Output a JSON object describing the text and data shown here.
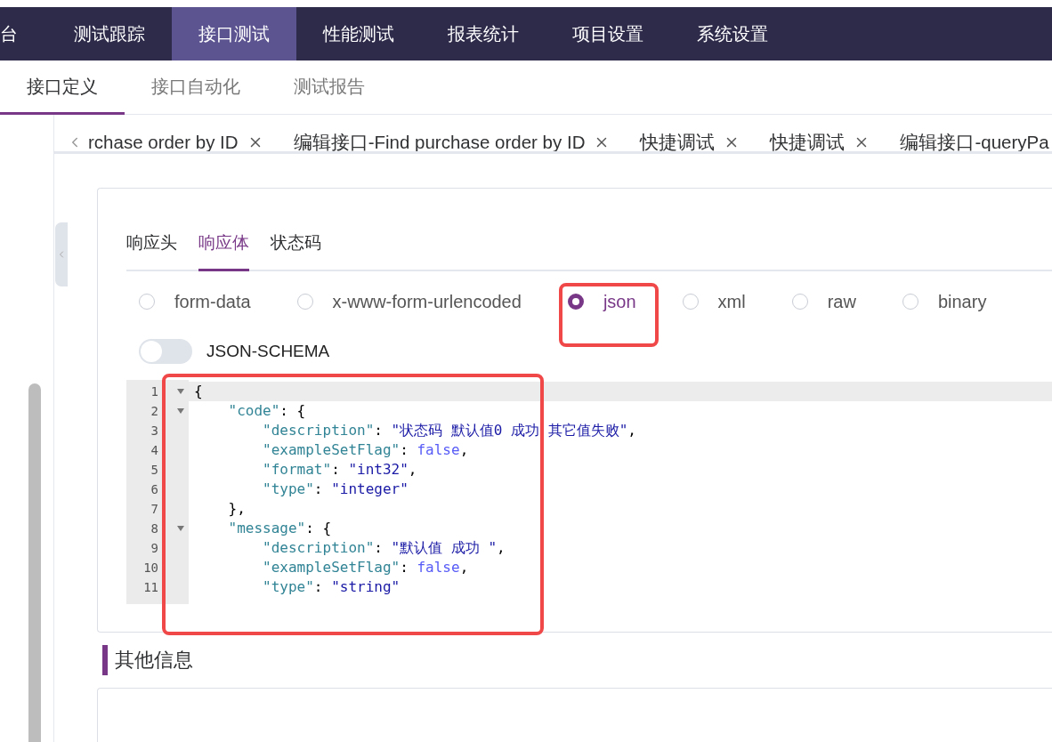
{
  "top_nav": [
    {
      "label": "台",
      "selected": false
    },
    {
      "label": "测试跟踪",
      "selected": false
    },
    {
      "label": "接口测试",
      "selected": true
    },
    {
      "label": "性能测试",
      "selected": false
    },
    {
      "label": "报表统计",
      "selected": false
    },
    {
      "label": "项目设置",
      "selected": false
    },
    {
      "label": "系统设置",
      "selected": false
    }
  ],
  "sub_nav": [
    {
      "label": "接口定义",
      "selected": true
    },
    {
      "label": "接口自动化",
      "selected": false
    },
    {
      "label": "测试报告",
      "selected": false
    }
  ],
  "open_tabs": [
    {
      "label": "rchase order by ID",
      "closable": true
    },
    {
      "label": "编辑接口-Find purchase order by ID",
      "closable": true
    },
    {
      "label": "快捷调试",
      "closable": true
    },
    {
      "label": "快捷调试",
      "closable": true
    },
    {
      "label": "编辑接口-queryPa",
      "closable": false
    }
  ],
  "response_tabs": [
    {
      "label": "响应头",
      "selected": false
    },
    {
      "label": "响应体",
      "selected": true
    },
    {
      "label": "状态码",
      "selected": false
    }
  ],
  "body_types": [
    {
      "label": "form-data",
      "selected": false
    },
    {
      "label": "x-www-form-urlencoded",
      "selected": false
    },
    {
      "label": "json",
      "selected": true
    },
    {
      "label": "xml",
      "selected": false
    },
    {
      "label": "raw",
      "selected": false
    },
    {
      "label": "binary",
      "selected": false
    }
  ],
  "json_schema": {
    "label": "JSON-SCHEMA",
    "on": false
  },
  "editor_lines": [
    {
      "number": "1",
      "fold": true,
      "tokens": [
        {
          "kind": "punct",
          "text": "{"
        }
      ]
    },
    {
      "number": "2",
      "fold": true,
      "tokens": [
        {
          "kind": "key",
          "text": "    \"code\""
        },
        {
          "kind": "punct",
          "text": ": {"
        }
      ]
    },
    {
      "number": "3",
      "fold": false,
      "tokens": [
        {
          "kind": "key",
          "text": "        \"description\""
        },
        {
          "kind": "punct",
          "text": ": "
        },
        {
          "kind": "string",
          "text": "\"状态码 默认值0 成功 其它值失败\""
        },
        {
          "kind": "punct",
          "text": ","
        }
      ]
    },
    {
      "number": "4",
      "fold": false,
      "tokens": [
        {
          "kind": "key",
          "text": "        \"exampleSetFlag\""
        },
        {
          "kind": "punct",
          "text": ": "
        },
        {
          "kind": "bool",
          "text": "false"
        },
        {
          "kind": "punct",
          "text": ","
        }
      ]
    },
    {
      "number": "5",
      "fold": false,
      "tokens": [
        {
          "kind": "key",
          "text": "        \"format\""
        },
        {
          "kind": "punct",
          "text": ": "
        },
        {
          "kind": "string",
          "text": "\"int32\""
        },
        {
          "kind": "punct",
          "text": ","
        }
      ]
    },
    {
      "number": "6",
      "fold": false,
      "tokens": [
        {
          "kind": "key",
          "text": "        \"type\""
        },
        {
          "kind": "punct",
          "text": ": "
        },
        {
          "kind": "string",
          "text": "\"integer\""
        }
      ]
    },
    {
      "number": "7",
      "fold": false,
      "tokens": [
        {
          "kind": "punct",
          "text": "    },"
        }
      ]
    },
    {
      "number": "8",
      "fold": true,
      "tokens": [
        {
          "kind": "key",
          "text": "    \"message\""
        },
        {
          "kind": "punct",
          "text": ": {"
        }
      ]
    },
    {
      "number": "9",
      "fold": false,
      "tokens": [
        {
          "kind": "key",
          "text": "        \"description\""
        },
        {
          "kind": "punct",
          "text": ": "
        },
        {
          "kind": "string",
          "text": "\"默认值 成功 \""
        },
        {
          "kind": "punct",
          "text": ","
        }
      ]
    },
    {
      "number": "10",
      "fold": false,
      "tokens": [
        {
          "kind": "key",
          "text": "        \"exampleSetFlag\""
        },
        {
          "kind": "punct",
          "text": ": "
        },
        {
          "kind": "bool",
          "text": "false"
        },
        {
          "kind": "punct",
          "text": ","
        }
      ]
    },
    {
      "number": "11",
      "fold": false,
      "tokens": [
        {
          "kind": "key",
          "text": "        \"type\""
        },
        {
          "kind": "punct",
          "text": ": "
        },
        {
          "kind": "string",
          "text": "\"string\""
        }
      ]
    }
  ],
  "other_section": {
    "title": "其他信息"
  }
}
